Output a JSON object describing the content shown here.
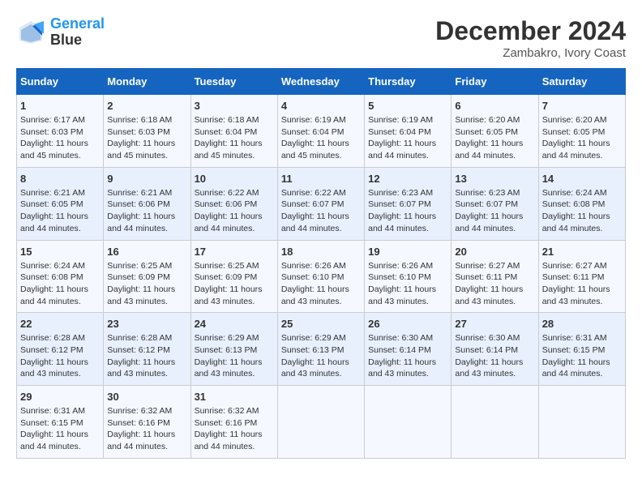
{
  "logo": {
    "line1": "General",
    "line2": "Blue"
  },
  "title": "December 2024",
  "subtitle": "Zambakro, Ivory Coast",
  "days_of_week": [
    "Sunday",
    "Monday",
    "Tuesday",
    "Wednesday",
    "Thursday",
    "Friday",
    "Saturday"
  ],
  "weeks": [
    [
      {
        "day": "1",
        "sunrise": "6:17 AM",
        "sunset": "6:03 PM",
        "daylight": "11 hours and 45 minutes."
      },
      {
        "day": "2",
        "sunrise": "6:18 AM",
        "sunset": "6:03 PM",
        "daylight": "11 hours and 45 minutes."
      },
      {
        "day": "3",
        "sunrise": "6:18 AM",
        "sunset": "6:04 PM",
        "daylight": "11 hours and 45 minutes."
      },
      {
        "day": "4",
        "sunrise": "6:19 AM",
        "sunset": "6:04 PM",
        "daylight": "11 hours and 45 minutes."
      },
      {
        "day": "5",
        "sunrise": "6:19 AM",
        "sunset": "6:04 PM",
        "daylight": "11 hours and 44 minutes."
      },
      {
        "day": "6",
        "sunrise": "6:20 AM",
        "sunset": "6:05 PM",
        "daylight": "11 hours and 44 minutes."
      },
      {
        "day": "7",
        "sunrise": "6:20 AM",
        "sunset": "6:05 PM",
        "daylight": "11 hours and 44 minutes."
      }
    ],
    [
      {
        "day": "8",
        "sunrise": "6:21 AM",
        "sunset": "6:05 PM",
        "daylight": "11 hours and 44 minutes."
      },
      {
        "day": "9",
        "sunrise": "6:21 AM",
        "sunset": "6:06 PM",
        "daylight": "11 hours and 44 minutes."
      },
      {
        "day": "10",
        "sunrise": "6:22 AM",
        "sunset": "6:06 PM",
        "daylight": "11 hours and 44 minutes."
      },
      {
        "day": "11",
        "sunrise": "6:22 AM",
        "sunset": "6:07 PM",
        "daylight": "11 hours and 44 minutes."
      },
      {
        "day": "12",
        "sunrise": "6:23 AM",
        "sunset": "6:07 PM",
        "daylight": "11 hours and 44 minutes."
      },
      {
        "day": "13",
        "sunrise": "6:23 AM",
        "sunset": "6:07 PM",
        "daylight": "11 hours and 44 minutes."
      },
      {
        "day": "14",
        "sunrise": "6:24 AM",
        "sunset": "6:08 PM",
        "daylight": "11 hours and 44 minutes."
      }
    ],
    [
      {
        "day": "15",
        "sunrise": "6:24 AM",
        "sunset": "6:08 PM",
        "daylight": "11 hours and 44 minutes."
      },
      {
        "day": "16",
        "sunrise": "6:25 AM",
        "sunset": "6:09 PM",
        "daylight": "11 hours and 43 minutes."
      },
      {
        "day": "17",
        "sunrise": "6:25 AM",
        "sunset": "6:09 PM",
        "daylight": "11 hours and 43 minutes."
      },
      {
        "day": "18",
        "sunrise": "6:26 AM",
        "sunset": "6:10 PM",
        "daylight": "11 hours and 43 minutes."
      },
      {
        "day": "19",
        "sunrise": "6:26 AM",
        "sunset": "6:10 PM",
        "daylight": "11 hours and 43 minutes."
      },
      {
        "day": "20",
        "sunrise": "6:27 AM",
        "sunset": "6:11 PM",
        "daylight": "11 hours and 43 minutes."
      },
      {
        "day": "21",
        "sunrise": "6:27 AM",
        "sunset": "6:11 PM",
        "daylight": "11 hours and 43 minutes."
      }
    ],
    [
      {
        "day": "22",
        "sunrise": "6:28 AM",
        "sunset": "6:12 PM",
        "daylight": "11 hours and 43 minutes."
      },
      {
        "day": "23",
        "sunrise": "6:28 AM",
        "sunset": "6:12 PM",
        "daylight": "11 hours and 43 minutes."
      },
      {
        "day": "24",
        "sunrise": "6:29 AM",
        "sunset": "6:13 PM",
        "daylight": "11 hours and 43 minutes."
      },
      {
        "day": "25",
        "sunrise": "6:29 AM",
        "sunset": "6:13 PM",
        "daylight": "11 hours and 43 minutes."
      },
      {
        "day": "26",
        "sunrise": "6:30 AM",
        "sunset": "6:14 PM",
        "daylight": "11 hours and 43 minutes."
      },
      {
        "day": "27",
        "sunrise": "6:30 AM",
        "sunset": "6:14 PM",
        "daylight": "11 hours and 43 minutes."
      },
      {
        "day": "28",
        "sunrise": "6:31 AM",
        "sunset": "6:15 PM",
        "daylight": "11 hours and 44 minutes."
      }
    ],
    [
      {
        "day": "29",
        "sunrise": "6:31 AM",
        "sunset": "6:15 PM",
        "daylight": "11 hours and 44 minutes."
      },
      {
        "day": "30",
        "sunrise": "6:32 AM",
        "sunset": "6:16 PM",
        "daylight": "11 hours and 44 minutes."
      },
      {
        "day": "31",
        "sunrise": "6:32 AM",
        "sunset": "6:16 PM",
        "daylight": "11 hours and 44 minutes."
      },
      null,
      null,
      null,
      null
    ]
  ]
}
